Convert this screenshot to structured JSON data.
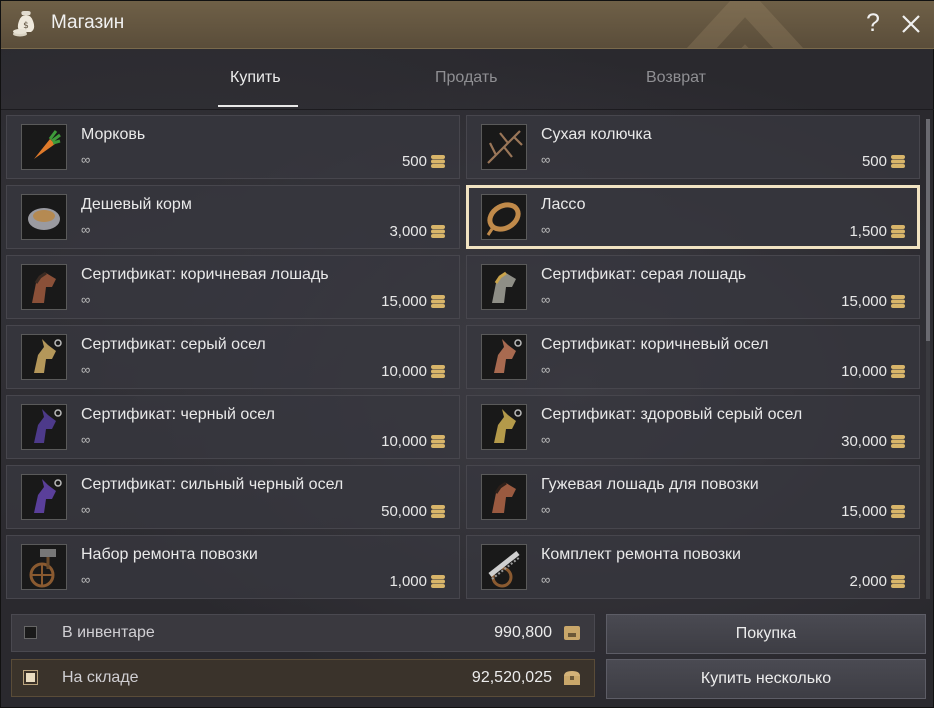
{
  "window": {
    "title": "Магазин",
    "help_label": "?"
  },
  "tabs": [
    {
      "label": "Купить",
      "active": true
    },
    {
      "label": "Продать",
      "active": false
    },
    {
      "label": "Возврат",
      "active": false
    }
  ],
  "items": [
    {
      "name": "Морковь",
      "stock": "∞",
      "price": "500",
      "icon": "carrot-icon"
    },
    {
      "name": "Сухая колючка",
      "stock": "∞",
      "price": "500",
      "icon": "dry-thorn-icon"
    },
    {
      "name": "Дешевый корм",
      "stock": "∞",
      "price": "3,000",
      "icon": "feed-bowl-icon"
    },
    {
      "name": "Лассо",
      "stock": "∞",
      "price": "1,500",
      "icon": "lasso-icon",
      "selected": true
    },
    {
      "name": "Сертификат: коричневая лошадь",
      "stock": "∞",
      "price": "15,000",
      "icon": "brown-horse-certificate-icon"
    },
    {
      "name": "Сертификат: серая лошадь",
      "stock": "∞",
      "price": "15,000",
      "icon": "gray-horse-certificate-icon"
    },
    {
      "name": "Сертификат: серый осел",
      "stock": "∞",
      "price": "10,000",
      "icon": "gray-donkey-certificate-icon"
    },
    {
      "name": "Сертификат: коричневый осел",
      "stock": "∞",
      "price": "10,000",
      "icon": "brown-donkey-certificate-icon"
    },
    {
      "name": "Сертификат: черный осел",
      "stock": "∞",
      "price": "10,000",
      "icon": "black-donkey-certificate-icon"
    },
    {
      "name": "Сертификат: здоровый серый осел",
      "stock": "∞",
      "price": "30,000",
      "icon": "healthy-gray-donkey-certificate-icon"
    },
    {
      "name": "Сертификат: сильный черный осел",
      "stock": "∞",
      "price": "50,000",
      "icon": "strong-black-donkey-certificate-icon"
    },
    {
      "name": "Гужевая лошадь для повозки",
      "stock": "∞",
      "price": "15,000",
      "icon": "draft-horse-icon"
    },
    {
      "name": "Набор ремонта повозки",
      "stock": "∞",
      "price": "1,000",
      "icon": "wagon-repair-kit-icon"
    },
    {
      "name": "Комплект ремонта повозки",
      "stock": "∞",
      "price": "2,000",
      "icon": "wagon-repair-set-icon"
    }
  ],
  "inventory": {
    "label": "В инвентаре",
    "amount": "990,800",
    "checked": false
  },
  "warehouse": {
    "label": "На складе",
    "amount": "92,520,025",
    "checked": true
  },
  "buttons": {
    "buy": "Покупка",
    "buy_multiple": "Купить несколько"
  },
  "colors": {
    "titlebar": "#6f6047",
    "selected_border": "#f1e3c2",
    "coin": "#d8b56a"
  }
}
